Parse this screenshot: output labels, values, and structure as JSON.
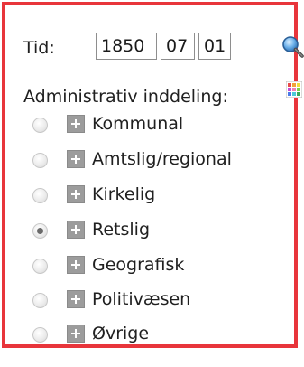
{
  "time": {
    "label": "Tid:",
    "year": "1850",
    "month": "07",
    "day": "01",
    "search_icon": "magnifier-icon"
  },
  "admin": {
    "label": "Administrativ inddeling:",
    "grid_icon": "color-grid-icon"
  },
  "options": [
    {
      "label": "Kommunal",
      "selected": false
    },
    {
      "label": "Amtslig/regional",
      "selected": false
    },
    {
      "label": "Kirkelig",
      "selected": false
    },
    {
      "label": "Retslig",
      "selected": true
    },
    {
      "label": "Geografisk",
      "selected": false
    },
    {
      "label": "Politivæsen",
      "selected": false
    },
    {
      "label": "Øvrige",
      "selected": false
    }
  ],
  "colors": {
    "border": "#e8353b",
    "expand_box": "#9c9c9c",
    "search_lens": "#3b86c6"
  }
}
